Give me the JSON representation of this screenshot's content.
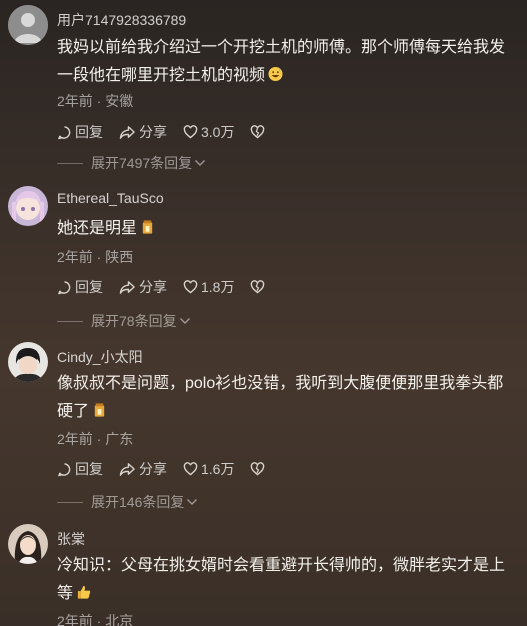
{
  "comments": [
    {
      "username": "用户7147928336789",
      "text": "我妈以前给我介绍过一个开挖土机的师傅。那个师傅每天给我发一段他在哪里开挖土机的视频",
      "emoji": "grinning-sweat-emoji",
      "time_location": "2年前 · 安徽",
      "reply_label": "回复",
      "share_label": "分享",
      "likes": "3.0万",
      "expand_label": "展开7497条回复"
    },
    {
      "username": "Ethereal_TauSco",
      "text": "她还是明星",
      "emoji": "tea-emoji",
      "time_location": "2年前 · 陕西",
      "reply_label": "回复",
      "share_label": "分享",
      "likes": "1.8万",
      "expand_label": "展开78条回复"
    },
    {
      "username": "Cindy_小太阳",
      "text": "像叔叔不是问题，polo衫也没错，我听到大腹便便那里我拳头都硬了",
      "emoji": "tea-emoji",
      "time_location": "2年前 · 广东",
      "reply_label": "回复",
      "share_label": "分享",
      "likes": "1.6万",
      "expand_label": "展开146条回复"
    },
    {
      "username": "张棠",
      "text": "冷知识：父母在挑女婿时会看重避开长得帅的，微胖老实才是上等",
      "emoji": "thumbs-up-emoji",
      "time_location": "2年前 · 北京"
    }
  ]
}
